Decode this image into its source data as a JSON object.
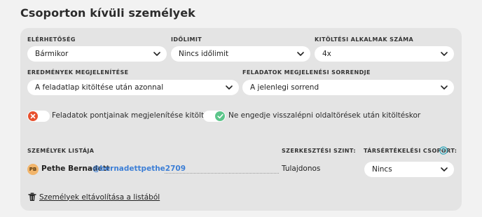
{
  "page": {
    "title": "Csoporton kívüli személyek"
  },
  "settings": {
    "availability": {
      "label": "ELÉRHETŐSÉG",
      "value": "Bármikor"
    },
    "time_limit": {
      "label": "IDŐLIMIT",
      "value": "Nincs időlimit"
    },
    "attempts": {
      "label": "KITÖLTÉSI ALKALMAK SZÁMA",
      "value": "4x"
    },
    "results_display": {
      "label": "EREDMÉNYEK MEGJELENÍTÉSE",
      "value": "A feladatlap kitöltése után azonnal"
    },
    "task_order": {
      "label": "FELADATOK MEGJELENÉSI SORRENDJE",
      "value": "A jelenlegi sorrend"
    }
  },
  "toggles": {
    "show_points": {
      "label": "Feladatok pontjainak megjelenítése kitöltéskor",
      "state": "off",
      "color": "#e8502e"
    },
    "no_back": {
      "label": "Ne engedje visszalépni oldaltörések után kitöltéskor",
      "state": "on",
      "color": "#5cc58a"
    }
  },
  "people": {
    "list_header": "SZEMÉLYEK LISTÁJA",
    "role_header": "SZERKESZTÉSI SZINT:",
    "peer_header": "TÁRSÉRTÉKELÉSI CSOPORT:",
    "rows": [
      {
        "initials": "PB",
        "name": "Pethe Bernadett",
        "handle": "@bernadettpethe2709",
        "role": "Tulajdonos",
        "peer_group": "Nincs"
      }
    ],
    "remove_label": "Személyek eltávolítása a listából"
  },
  "colors": {
    "accent_blue": "#3d7fd6",
    "help_teal": "#2aa4b8",
    "avatar": "#f2b56b"
  },
  "icons": {
    "chevron": "chevron-down-icon",
    "help": "help-circle-icon",
    "trash": "trash-icon"
  }
}
